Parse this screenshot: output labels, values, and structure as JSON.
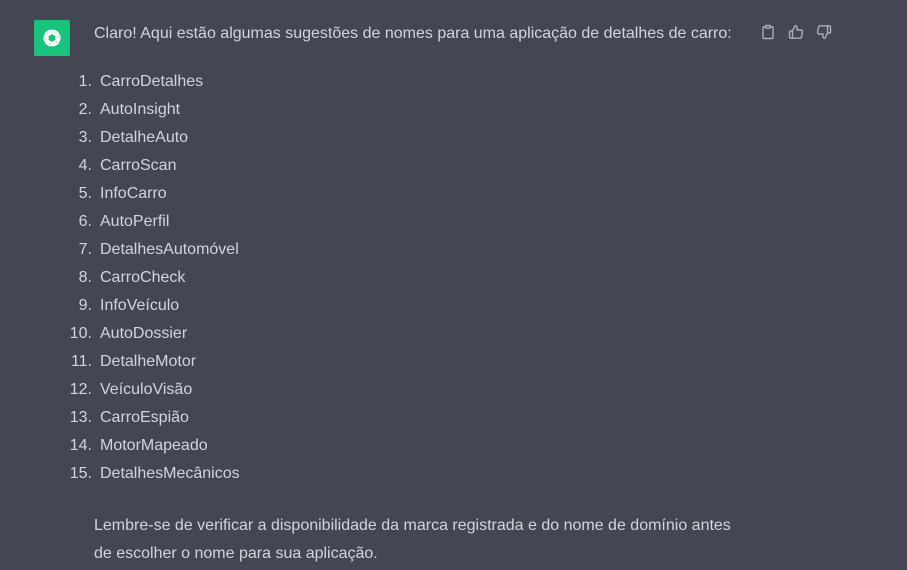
{
  "assistant": {
    "avatar_icon": "openai-logo-icon",
    "avatar_color": "#19c37d"
  },
  "message": {
    "intro": "Claro! Aqui estão algumas sugestões de nomes para uma aplicação de detalhes de carro:",
    "items": [
      {
        "number": "1.",
        "name": "CarroDetalhes"
      },
      {
        "number": "2.",
        "name": "AutoInsight"
      },
      {
        "number": "3.",
        "name": "DetalheAuto"
      },
      {
        "number": "4.",
        "name": "CarroScan"
      },
      {
        "number": "5.",
        "name": "InfoCarro"
      },
      {
        "number": "6.",
        "name": "AutoPerfil"
      },
      {
        "number": "7.",
        "name": "DetalhesAutomóvel"
      },
      {
        "number": "8.",
        "name": "CarroCheck"
      },
      {
        "number": "9.",
        "name": "InfoVeículo"
      },
      {
        "number": "10.",
        "name": "AutoDossier"
      },
      {
        "number": "11.",
        "name": "DetalheMotor"
      },
      {
        "number": "12.",
        "name": "VeículoVisão"
      },
      {
        "number": "13.",
        "name": "CarroEspião"
      },
      {
        "number": "14.",
        "name": "MotorMapeado"
      },
      {
        "number": "15.",
        "name": "DetalhesMecânicos"
      }
    ],
    "outro": "Lembre-se de verificar a disponibilidade da marca registrada e do nome de domínio antes de escolher o nome para sua aplicação."
  },
  "actions": [
    {
      "icon": "clipboard-icon"
    },
    {
      "icon": "thumbs-up-icon"
    },
    {
      "icon": "thumbs-down-icon"
    }
  ],
  "colors": {
    "background": "#444654",
    "text": "#d1d5db",
    "icon": "#acacbe"
  }
}
